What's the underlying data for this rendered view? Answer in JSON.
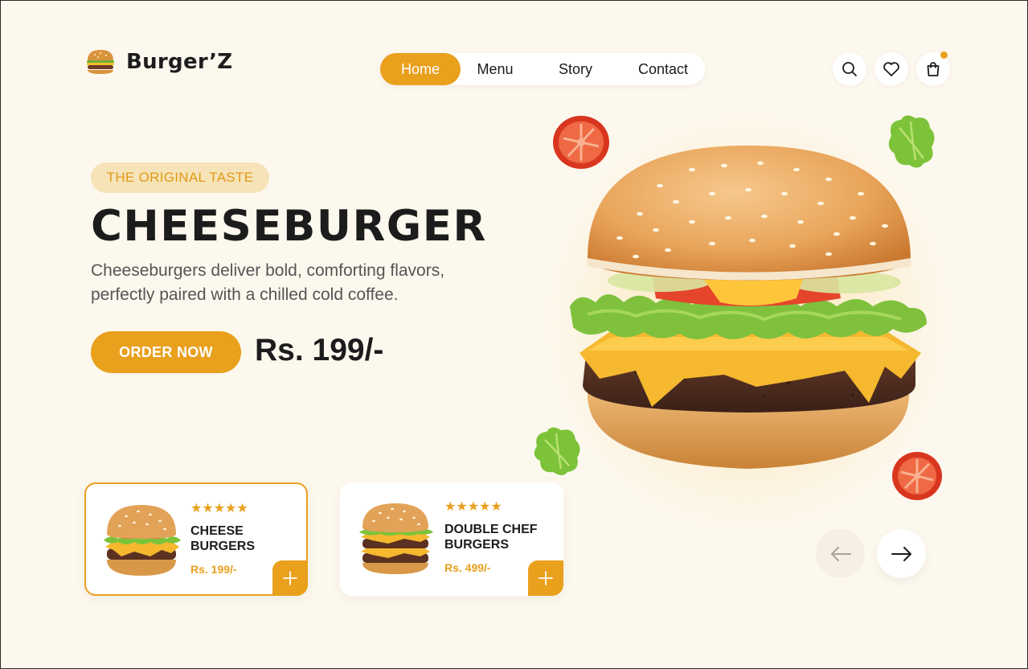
{
  "brand": {
    "name": "Burger’Z",
    "logo_icon": "burger-icon"
  },
  "nav": {
    "items": [
      {
        "label": "Home",
        "active": true
      },
      {
        "label": "Menu",
        "active": false
      },
      {
        "label": "Story",
        "active": false
      },
      {
        "label": "Contact",
        "active": false
      }
    ]
  },
  "header_actions": {
    "icons": [
      "search-icon",
      "heart-icon",
      "shopping-bag-icon"
    ],
    "cart_indicator": true
  },
  "hero": {
    "tagline": "THE ORIGINAL TASTE",
    "title": "CHEESEBURGER",
    "description": "Cheeseburgers deliver bold, comforting flavors, perfectly paired with a chilled cold coffee.",
    "order_label": "ORDER NOW",
    "price": "Rs. 199/-"
  },
  "products": [
    {
      "name": "CHEESE BURGERS",
      "price": "Rs. 199/-",
      "rating": 5,
      "stars": "★★★★★",
      "selected": true,
      "add_icon": "plus-icon"
    },
    {
      "name": "DOUBLE CHEF BURGERS",
      "price": "Rs. 499/-",
      "rating": 5,
      "stars": "★★★★★",
      "selected": false,
      "add_icon": "plus-icon"
    }
  ],
  "carousel": {
    "prev_icon": "arrow-left-icon",
    "next_icon": "arrow-right-icon"
  },
  "colors": {
    "accent": "#e9a01d",
    "background": "#fdf8ee",
    "tag_bg": "#f6e3b8",
    "text": "#1c1c1c"
  }
}
